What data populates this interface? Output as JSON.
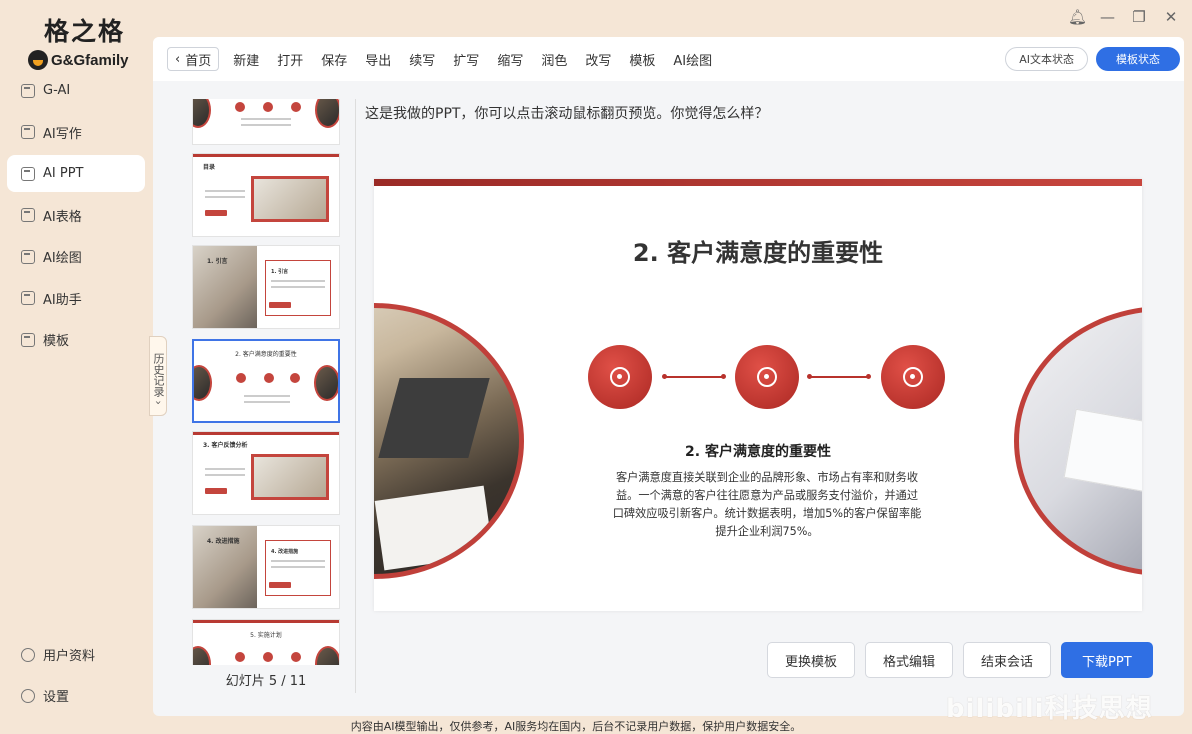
{
  "brand": {
    "title": "格之格",
    "subtitle": "G&Gfamily"
  },
  "nav": {
    "items": [
      {
        "label": "G-AI",
        "icon": "chat-icon"
      },
      {
        "label": "AI写作",
        "icon": "write-icon"
      },
      {
        "label": "AI PPT",
        "icon": "ppt-icon"
      },
      {
        "label": "AI表格",
        "icon": "table-icon"
      },
      {
        "label": "AI绘图",
        "icon": "paint-icon"
      },
      {
        "label": "AI助手",
        "icon": "assistant-icon"
      },
      {
        "label": "模板",
        "icon": "template-icon"
      }
    ],
    "bottom": [
      {
        "label": "用户资料",
        "icon": "user-icon"
      },
      {
        "label": "设置",
        "icon": "gear-icon"
      }
    ]
  },
  "toolbar": {
    "home": "首页",
    "items": [
      "新建",
      "打开",
      "保存",
      "导出",
      "续写",
      "扩写",
      "缩写",
      "润色",
      "改写",
      "模板",
      "AI绘图"
    ],
    "ai_text_status": "AI文本状态",
    "template_status": "模板状态"
  },
  "history_tab": "历史记录",
  "thumbs": {
    "t2_title": "目录",
    "t3_title": "1. 引言",
    "t3_box_title": "1. 引言",
    "t4_title": "2. 客户满意度的重要性",
    "t5_title": "3. 客户反馈分析",
    "t6_title": "4. 改进措施",
    "t6_box_title": "4. 改进措施",
    "t7_title": "5. 实施计划"
  },
  "slide_count": "幻灯片 5 / 11",
  "message": "这是我做的PPT，你可以点击滚动鼠标翻页预览。你觉得怎么样？",
  "slide": {
    "title": "2. 客户满意度的重要性",
    "subtitle": "2. 客户满意度的重要性",
    "body": "客户满意度直接关联到企业的品牌形象、市场占有率和财务收益。一个满意的客户往往愿意为产品或服务支付溢价，并通过口碑效应吸引新客户。统计数据表明，增加5%的客户保留率能提升企业利润75%。"
  },
  "actions": {
    "change_template": "更换模板",
    "format_edit": "格式编辑",
    "end_session": "结束会话",
    "download": "下载PPT"
  },
  "footer": "内容由AI模型输出，仅供参考，AI服务均在国内，后台不记录用户数据，保护用户数据安全。",
  "watermark": "bilibili科技思想",
  "colors": {
    "accent": "#2f6fe4",
    "slide_red": "#c0403a",
    "background": "#f5e6d6"
  }
}
